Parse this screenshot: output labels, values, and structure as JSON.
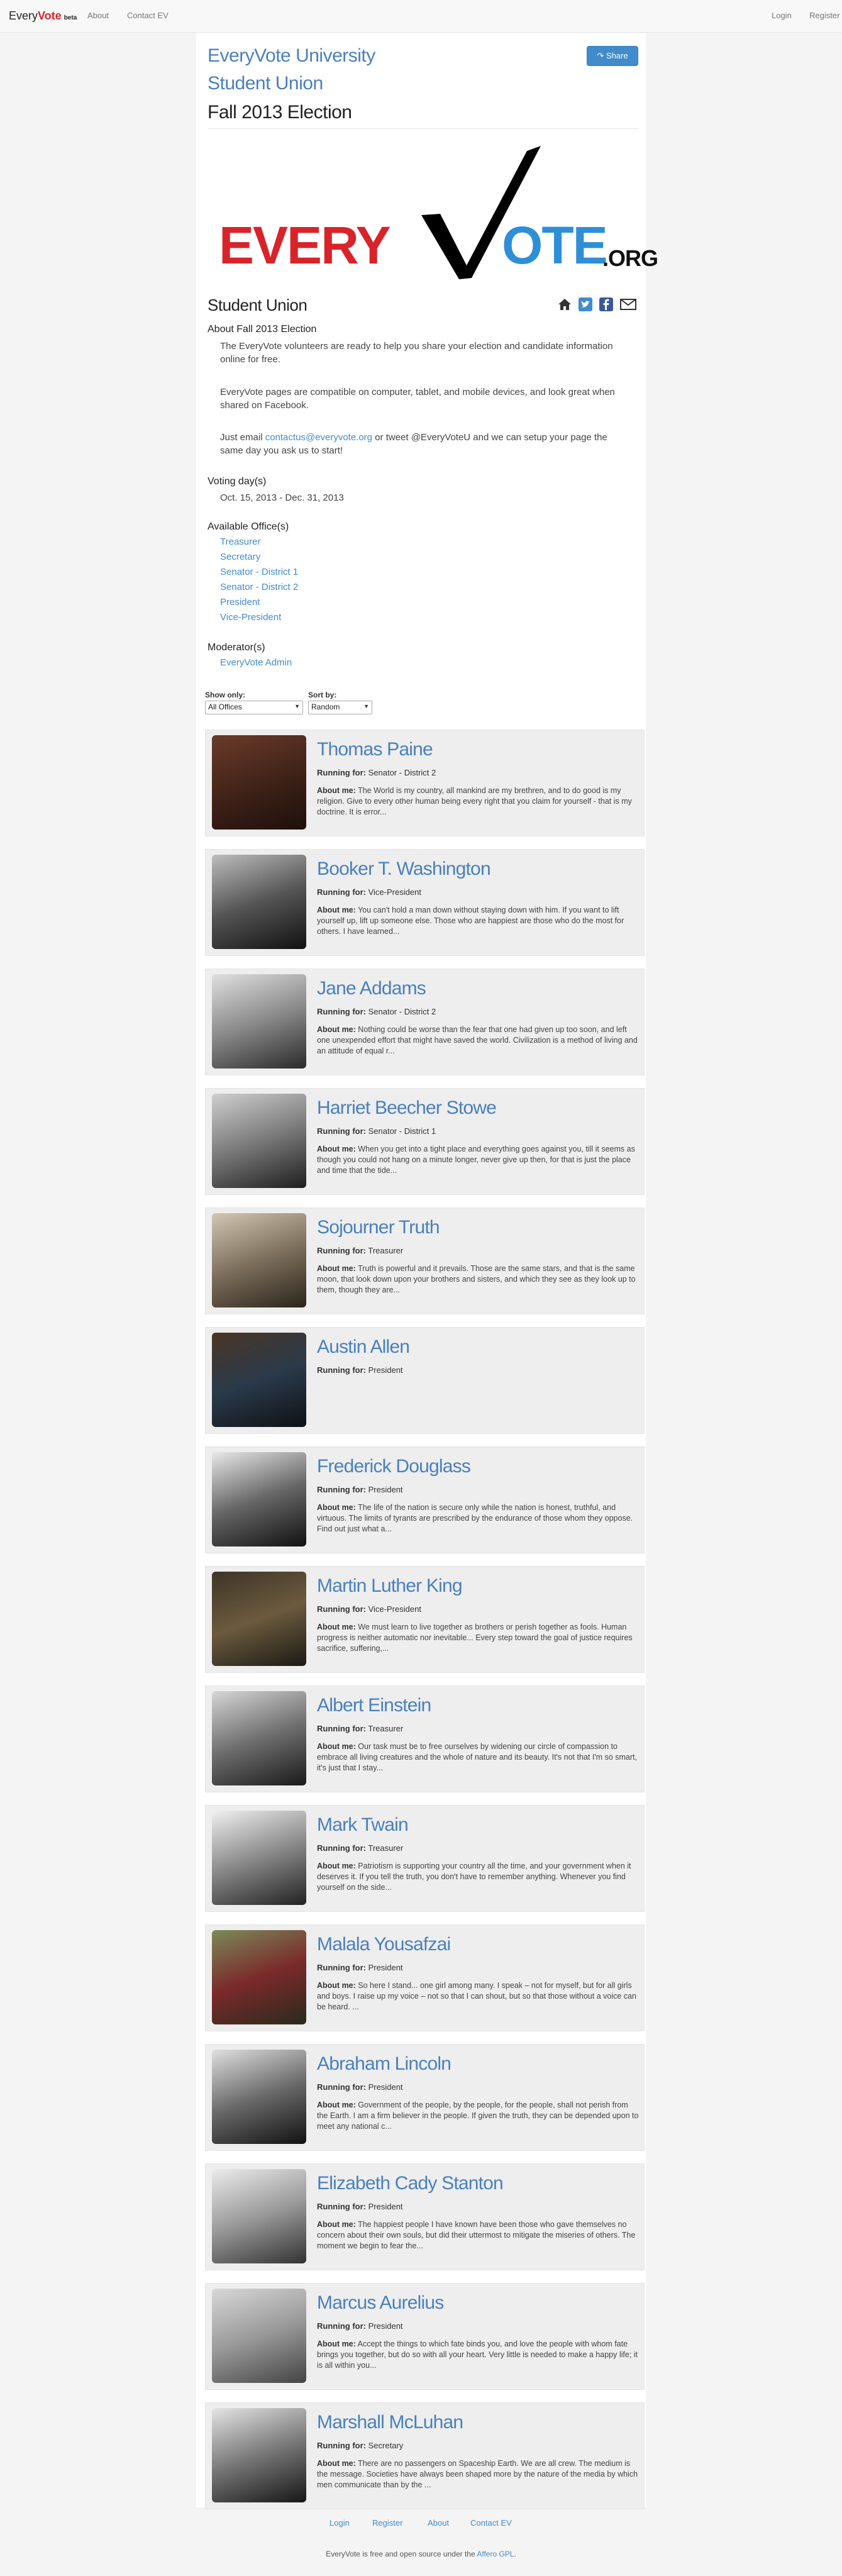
{
  "navbar": {
    "brand_every": "Every",
    "brand_vote": "Vote",
    "brand_beta": "beta",
    "about": "About",
    "contact": "Contact EV",
    "login": "Login",
    "register": "Register"
  },
  "header": {
    "university": "EveryVote University",
    "org": "Student Union",
    "election": "Fall 2013 Election",
    "share_label": "Share"
  },
  "logo": {
    "every": "EVERY",
    "ote": "OTE",
    "org": ".ORG"
  },
  "section": {
    "title": "Student Union",
    "about_label": "About Fall 2013 Election",
    "para1": "The EveryVote volunteers are ready to help you share your election and candidate information online for free.",
    "para2": "EveryVote pages are compatible on computer, tablet, and mobile devices, and look great when shared on Facebook.",
    "para3_pre": "Just email ",
    "para3_link": "contactus@everyvote.org",
    "para3_post": " or tweet @EveryVoteU and we can setup your page the same day you ask us to start!",
    "voting_label": "Voting day(s)",
    "voting_dates": "Oct. 15, 2013 - Dec. 31, 2013",
    "offices_label": "Available Office(s)",
    "offices": [
      "Treasurer",
      "Secretary",
      "Senator - District 1",
      "Senator - District 2",
      "President",
      "Vice-President"
    ],
    "moderator_label": "Moderator(s)",
    "moderator": "EveryVote Admin"
  },
  "filters": {
    "show_label": "Show only:",
    "show_value": "All Offices",
    "sort_label": "Sort by:",
    "sort_value": "Random"
  },
  "candidates": [
    {
      "name": "Thomas Paine",
      "running_label": "Running for:",
      "office": "Senator - District 2",
      "about_label": "About me:",
      "about": "The World is my country, all mankind are my brethren, and to do good is my religion. Give to every other human being every right that you claim for yourself - that is my doctrine. It is error..."
    },
    {
      "name": "Booker T. Washington",
      "running_label": "Running for:",
      "office": "Vice-President",
      "about_label": "About me:",
      "about": "You can't hold a man down without staying down with him. If you want to lift yourself up, lift up someone else. Those who are happiest are those who do the most for others. I have learned..."
    },
    {
      "name": "Jane Addams",
      "running_label": "Running for:",
      "office": "Senator - District 2",
      "about_label": "About me:",
      "about": "Nothing could be worse than the fear that one had given up too soon, and left one unexpended effort that might have saved the world. Civilization is a method of living and an attitude of equal r..."
    },
    {
      "name": "Harriet Beecher Stowe",
      "running_label": "Running for:",
      "office": "Senator - District 1",
      "about_label": "About me:",
      "about": "When you get into a tight place and everything goes against you, till it seems as though you could not hang on a minute longer, never give up then, for that is just the place and time that the tide..."
    },
    {
      "name": "Sojourner Truth",
      "running_label": "Running for:",
      "office": "Treasurer",
      "about_label": "About me:",
      "about": "Truth is powerful and it prevails. Those are the same stars, and that is the same moon, that look down upon your brothers and sisters, and which they see as they look up to them, though they are..."
    },
    {
      "name": "Austin Allen",
      "running_label": "Running for:",
      "office": "President",
      "about_label": "",
      "about": ""
    },
    {
      "name": "Frederick Douglass",
      "running_label": "Running for:",
      "office": "President",
      "about_label": "About me:",
      "about": "The life of the nation is secure only while the nation is honest, truthful, and virtuous. The limits of tyrants are prescribed by the endurance of those whom they oppose. Find out just what a..."
    },
    {
      "name": "Martin Luther King",
      "running_label": "Running for:",
      "office": "Vice-President",
      "about_label": "About me:",
      "about": "We must learn to live together as brothers or perish together as fools. Human progress is neither automatic nor inevitable... Every step toward the goal of justice requires sacrifice, suffering,..."
    },
    {
      "name": "Albert Einstein",
      "running_label": "Running for:",
      "office": "Treasurer",
      "about_label": "About me:",
      "about": "Our task must be to free ourselves by widening our circle of compassion to embrace all living creatures and the whole of nature and its beauty. It's not that I'm so smart, it's just that I stay..."
    },
    {
      "name": "Mark Twain",
      "running_label": "Running for:",
      "office": "Treasurer",
      "about_label": "About me:",
      "about": "Patriotism is supporting your country all the time, and your government when it deserves it. If you tell the truth, you don't have to remember anything. Whenever you find yourself on the side..."
    },
    {
      "name": "Malala Yousafzai",
      "running_label": "Running for:",
      "office": "President",
      "about_label": "About me:",
      "about": "So here I stand... one girl among many. I speak – not for myself, but for all girls and boys. I raise up my voice – not so that I can shout, but so that those without a voice can be heard. ..."
    },
    {
      "name": "Abraham Lincoln",
      "running_label": "Running for:",
      "office": "President",
      "about_label": "About me:",
      "about": "Government of the people, by the people, for the people, shall not perish from the Earth. I am a firm believer in the people. If given the truth, they can be depended upon to meet any national c..."
    },
    {
      "name": "Elizabeth Cady Stanton",
      "running_label": "Running for:",
      "office": "President",
      "about_label": "About me:",
      "about": "The happiest people I have known have been those who gave themselves no concern about their own souls, but did their uttermost to mitigate the miseries of others. The moment we begin to fear the..."
    },
    {
      "name": "Marcus Aurelius",
      "running_label": "Running for:",
      "office": "President",
      "about_label": "About me:",
      "about": "Accept the things to which fate binds you, and love the people with whom fate brings you together, but do so with all your heart. Very little is needed to make a happy life; it is all within you..."
    },
    {
      "name": "Marshall McLuhan",
      "running_label": "Running for:",
      "office": "Secretary",
      "about_label": "About me:",
      "about": "There are no passengers on Spaceship Earth. We are all crew. The medium is the message. Societies have always been shaped more by the nature of the media by which men communicate than by the ..."
    }
  ],
  "footer": {
    "login": "Login",
    "register": "Register",
    "about": "About",
    "contact": "Contact EV",
    "text_pre": "EveryVote is free and open source under the ",
    "text_link": "Affero GPL",
    "text_post": "."
  },
  "colors": {
    "link": "#428bca",
    "heading_blue": "#4a80bd",
    "logo_red": "#d9232a",
    "logo_blue": "#2e8fd6"
  }
}
